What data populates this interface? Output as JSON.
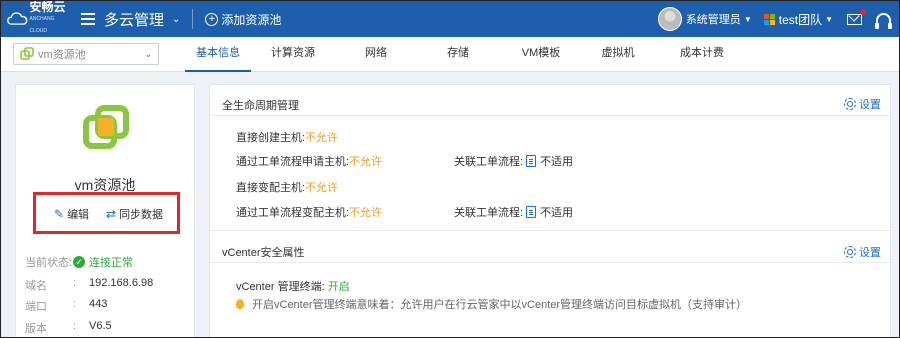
{
  "topbar": {
    "logo_text": "安畅云",
    "logo_sub": "ANCHANG CLOUD",
    "app_title": "多云管理",
    "add_pool_label": "添加资源池",
    "user_name": "系统管理员",
    "team_name": "test团队"
  },
  "pool_select": {
    "value": "vm资源池"
  },
  "tabs": [
    {
      "label": "基本信息",
      "active": true
    },
    {
      "label": "计算资源"
    },
    {
      "label": "网络"
    },
    {
      "label": "存储"
    },
    {
      "label": "VM模板"
    },
    {
      "label": "虚拟机"
    },
    {
      "label": "成本计费"
    }
  ],
  "left": {
    "pool_name": "vm资源池",
    "edit_label": "编辑",
    "sync_label": "同步数据",
    "info": [
      {
        "label": "当前状态:",
        "colon": "",
        "value": "连接正常"
      },
      {
        "label": "域名",
        "colon": ":",
        "value": "192.168.6.98"
      },
      {
        "label": "端口",
        "colon": ":",
        "value": "443"
      },
      {
        "label": "版本",
        "colon": ":",
        "value": "V6.5"
      }
    ]
  },
  "lifecycle": {
    "title": "全生命周期管理",
    "settings_label": "设置",
    "rows": [
      {
        "label": "直接创建主机:",
        "value": "不允许"
      },
      {
        "label": "通过工单流程申请主机:",
        "value": "不允许",
        "flow_label": "关联工单流程:",
        "flow_value": "不适用"
      },
      {
        "label": "直接变配主机:",
        "value": "不允许"
      },
      {
        "label": "通过工单流程变配主机:",
        "value": "不允许",
        "flow_label": "关联工单流程:",
        "flow_value": "不适用"
      }
    ]
  },
  "vcenter": {
    "title": "vCenter安全属性",
    "settings_label": "设置",
    "terminal_label": "vCenter 管理终端:",
    "terminal_value": "开启",
    "tip": "开启vCenter管理终端意味着：允许用户在行云管家中以vCenter管理终端访问目标虚拟机（支持审计）"
  },
  "colors": {
    "brand": "#1d5fad",
    "warn": "#f0a020",
    "ok": "#2eaa3a",
    "highlight": "#e2262a"
  }
}
